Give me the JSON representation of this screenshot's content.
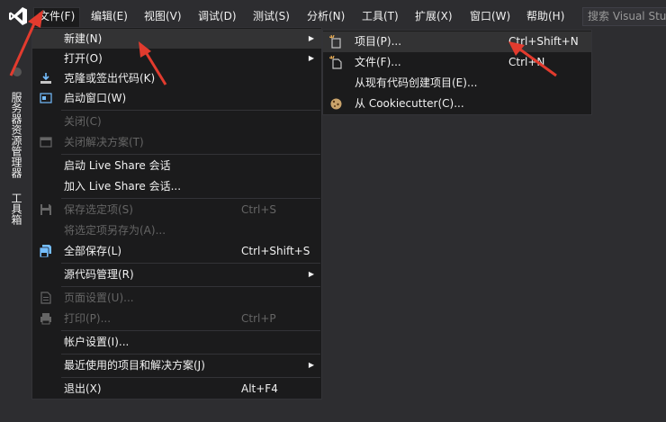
{
  "colors": {
    "background": "#2d2d30",
    "menu_background": "#1b1b1c",
    "highlight": "#333334",
    "disabled_text": "#656565",
    "text": "#f1f1f1",
    "annotation_arrow": "#e23b2e",
    "logo": "#ffffff"
  },
  "menubar": {
    "items": [
      {
        "label": "文件(F)",
        "name": "menu-file"
      },
      {
        "label": "编辑(E)",
        "name": "menu-edit"
      },
      {
        "label": "视图(V)",
        "name": "menu-view"
      },
      {
        "label": "调试(D)",
        "name": "menu-debug"
      },
      {
        "label": "测试(S)",
        "name": "menu-test"
      },
      {
        "label": "分析(N)",
        "name": "menu-analyze"
      },
      {
        "label": "工具(T)",
        "name": "menu-tools"
      },
      {
        "label": "扩展(X)",
        "name": "menu-extensions"
      },
      {
        "label": "窗口(W)",
        "name": "menu-window"
      },
      {
        "label": "帮助(H)",
        "name": "menu-help"
      }
    ],
    "search_placeholder": "搜索 Visual Studio"
  },
  "side_tabs": {
    "server_explorer": "服务器资源管理器",
    "toolbox": "工具箱"
  },
  "file_menu": {
    "rows": [
      {
        "label": "新建(N)",
        "shortcut": "",
        "submenu": true,
        "highlight": true,
        "disabled": false,
        "icon": ""
      },
      {
        "label": "打开(O)",
        "shortcut": "",
        "submenu": true,
        "disabled": false,
        "icon": ""
      },
      {
        "label": "克隆或签出代码(K)",
        "shortcut": "",
        "disabled": false,
        "icon": "clone-icon"
      },
      {
        "label": "启动窗口(W)",
        "shortcut": "",
        "disabled": false,
        "icon": "start-window-icon"
      },
      {
        "label": "关闭(C)",
        "shortcut": "",
        "disabled": true,
        "icon": ""
      },
      {
        "label": "关闭解决方案(T)",
        "shortcut": "",
        "disabled": true,
        "icon": "close-solution-icon"
      },
      {
        "label": "启动 Live Share 会话",
        "shortcut": "",
        "disabled": false,
        "icon": ""
      },
      {
        "label": "加入 Live Share 会话...",
        "shortcut": "",
        "disabled": false,
        "icon": ""
      },
      {
        "label": "保存选定项(S)",
        "shortcut": "Ctrl+S",
        "disabled": true,
        "icon": "save-icon"
      },
      {
        "label": "将选定项另存为(A)...",
        "shortcut": "",
        "disabled": true,
        "icon": ""
      },
      {
        "label": "全部保存(L)",
        "shortcut": "Ctrl+Shift+S",
        "disabled": false,
        "icon": "save-all-icon"
      },
      {
        "label": "源代码管理(R)",
        "shortcut": "",
        "submenu": true,
        "disabled": false,
        "icon": ""
      },
      {
        "label": "页面设置(U)...",
        "shortcut": "",
        "disabled": true,
        "icon": "page-setup-icon"
      },
      {
        "label": "打印(P)...",
        "shortcut": "Ctrl+P",
        "disabled": true,
        "icon": "print-icon"
      },
      {
        "label": "帐户设置(I)...",
        "shortcut": "",
        "disabled": false,
        "icon": ""
      },
      {
        "label": "最近使用的项目和解决方案(J)",
        "shortcut": "",
        "submenu": true,
        "disabled": false,
        "icon": ""
      },
      {
        "label": "退出(X)",
        "shortcut": "Alt+F4",
        "disabled": false,
        "icon": ""
      }
    ]
  },
  "new_submenu": {
    "rows": [
      {
        "label": "项目(P)...",
        "shortcut": "Ctrl+Shift+N",
        "highlight": true,
        "icon": "new-project-icon"
      },
      {
        "label": "文件(F)...",
        "shortcut": "Ctrl+N",
        "icon": "new-file-icon"
      },
      {
        "label": "从现有代码创建项目(E)...",
        "shortcut": "",
        "icon": ""
      },
      {
        "label": "从 Cookiecutter(C)...",
        "shortcut": "",
        "icon": "cookiecutter-icon"
      }
    ]
  }
}
